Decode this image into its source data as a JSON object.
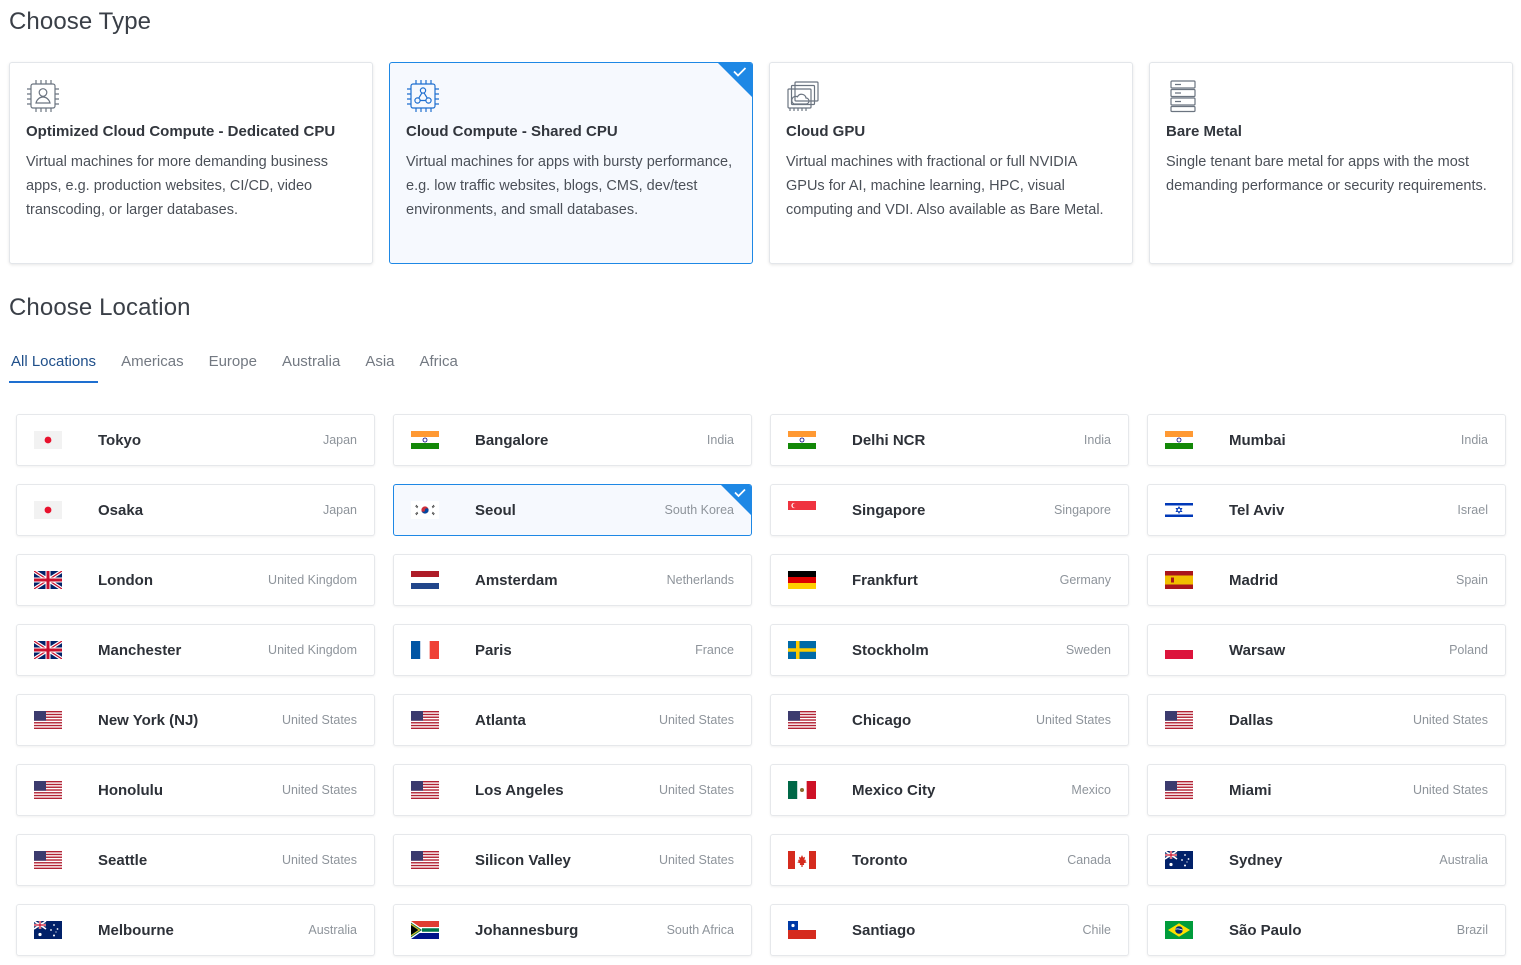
{
  "type_section": {
    "title": "Choose Type",
    "cards": [
      {
        "icon": "cpu-user-icon",
        "name": "Optimized Cloud Compute - Dedicated CPU",
        "desc": "Virtual machines for more demanding business apps, e.g. production websites, CI/CD, video transcoding, or larger databases.",
        "selected": false
      },
      {
        "icon": "cpu-network-icon",
        "name": "Cloud Compute - Shared CPU",
        "desc": "Virtual machines for apps with bursty performance, e.g. low traffic websites, blogs, CMS, dev/test environments, and small databases.",
        "selected": true
      },
      {
        "icon": "gpu-cloud-icon",
        "name": "Cloud GPU",
        "desc": "Virtual machines with fractional or full NVIDIA GPUs for AI, machine learning, HPC, visual computing and VDI. Also available as Bare Metal.",
        "selected": false
      },
      {
        "icon": "server-stack-icon",
        "name": "Bare Metal",
        "desc": "Single tenant bare metal for apps with the most demanding performance or security requirements.",
        "selected": false
      }
    ]
  },
  "location_section": {
    "title": "Choose Location",
    "tabs": [
      {
        "label": "All Locations",
        "active": true
      },
      {
        "label": "Americas",
        "active": false
      },
      {
        "label": "Europe",
        "active": false
      },
      {
        "label": "Australia",
        "active": false
      },
      {
        "label": "Asia",
        "active": false
      },
      {
        "label": "Africa",
        "active": false
      }
    ],
    "locations": [
      {
        "city": "Tokyo",
        "country": "Japan",
        "flag": "jp"
      },
      {
        "city": "Bangalore",
        "country": "India",
        "flag": "in"
      },
      {
        "city": "Delhi NCR",
        "country": "India",
        "flag": "in"
      },
      {
        "city": "Mumbai",
        "country": "India",
        "flag": "in"
      },
      {
        "city": "Osaka",
        "country": "Japan",
        "flag": "jp"
      },
      {
        "city": "Seoul",
        "country": "South Korea",
        "flag": "kr",
        "selected": true
      },
      {
        "city": "Singapore",
        "country": "Singapore",
        "flag": "sg"
      },
      {
        "city": "Tel Aviv",
        "country": "Israel",
        "flag": "il"
      },
      {
        "city": "London",
        "country": "United Kingdom",
        "flag": "gb"
      },
      {
        "city": "Amsterdam",
        "country": "Netherlands",
        "flag": "nl"
      },
      {
        "city": "Frankfurt",
        "country": "Germany",
        "flag": "de"
      },
      {
        "city": "Madrid",
        "country": "Spain",
        "flag": "es"
      },
      {
        "city": "Manchester",
        "country": "United Kingdom",
        "flag": "gb"
      },
      {
        "city": "Paris",
        "country": "France",
        "flag": "fr"
      },
      {
        "city": "Stockholm",
        "country": "Sweden",
        "flag": "se"
      },
      {
        "city": "Warsaw",
        "country": "Poland",
        "flag": "pl"
      },
      {
        "city": "New York (NJ)",
        "country": "United States",
        "flag": "us"
      },
      {
        "city": "Atlanta",
        "country": "United States",
        "flag": "us"
      },
      {
        "city": "Chicago",
        "country": "United States",
        "flag": "us"
      },
      {
        "city": "Dallas",
        "country": "United States",
        "flag": "us"
      },
      {
        "city": "Honolulu",
        "country": "United States",
        "flag": "us"
      },
      {
        "city": "Los Angeles",
        "country": "United States",
        "flag": "us"
      },
      {
        "city": "Mexico City",
        "country": "Mexico",
        "flag": "mx"
      },
      {
        "city": "Miami",
        "country": "United States",
        "flag": "us"
      },
      {
        "city": "Seattle",
        "country": "United States",
        "flag": "us"
      },
      {
        "city": "Silicon Valley",
        "country": "United States",
        "flag": "us"
      },
      {
        "city": "Toronto",
        "country": "Canada",
        "flag": "ca"
      },
      {
        "city": "Sydney",
        "country": "Australia",
        "flag": "au"
      },
      {
        "city": "Melbourne",
        "country": "Australia",
        "flag": "au"
      },
      {
        "city": "Johannesburg",
        "country": "South Africa",
        "flag": "za"
      },
      {
        "city": "Santiago",
        "country": "Chile",
        "flag": "cl"
      },
      {
        "city": "São Paulo",
        "country": "Brazil",
        "flag": "br"
      }
    ]
  },
  "colors": {
    "accent": "#1e88e5",
    "selected_bg": "#f6f9fe",
    "icon_stroke": "#6b7480"
  }
}
